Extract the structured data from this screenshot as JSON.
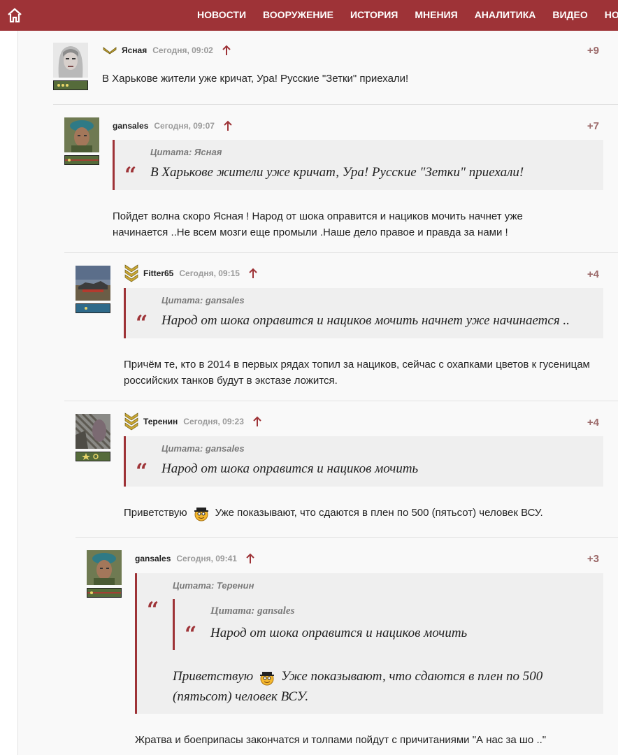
{
  "nav": {
    "home_icon": "home-icon",
    "items": [
      "НОВОСТИ",
      "ВООРУЖЕНИЕ",
      "ИСТОРИЯ",
      "МНЕНИЯ",
      "АНАЛИТИКА",
      "ВИДЕО",
      "НО"
    ]
  },
  "comments": [
    {
      "author": "Ясная",
      "time": "Сегодня, 09:02",
      "score": "+9",
      "text": "В Харькове жители уже кричат, Ура! Русские \"Зетки\" приехали!"
    },
    {
      "author": "gansales",
      "time": "Сегодня, 09:07",
      "score": "+7",
      "quote": {
        "head": "Цитата: Ясная",
        "text": "В Харькове жители уже кричат, Ура! Русские \"Зетки\" приехали!"
      },
      "text": "Пойдет волна скоро Ясная ! Народ от шока оправится и нациков мочить начнет уже начинается ..Не всем мозги еще промыли .Наше дело правое и правда за нами !"
    },
    {
      "author": "Fitter65",
      "time": "Сегодня, 09:15",
      "score": "+4",
      "quote": {
        "head": "Цитата: gansales",
        "text": "Народ от шока оправится и нациков мочить начнет уже начинается .."
      },
      "text": "Причём те, кто в 2014 в первых рядах топил за нациков, сейчас с охапками цветов к гусеницам российских танков будут в экстазе ложится."
    },
    {
      "author": "Теренин",
      "time": "Сегодня, 09:23",
      "score": "+4",
      "quote": {
        "head": "Цитата: gansales",
        "text": "Народ от шока оправится и нациков мочить"
      },
      "text_before": "Приветствую",
      "text_after": "Уже показывают, что сдаются в плен по 500 (пятьсот) человек ВСУ."
    },
    {
      "author": "gansales",
      "time": "Сегодня, 09:41",
      "score": "+3",
      "quote": {
        "head": "Цитата: Теренин",
        "inner_head": "Цитата: gansales",
        "inner_text": "Народ от шока оправится и нациков мочить",
        "text_before": "Приветствую",
        "text_after": "Уже показывают, что сдаются в плен по 500 (пятьсот) человек ВСУ."
      },
      "text": "Жратва и боеприпасы закончатся и толпами пойдут с причитаниями \"А нас за шо ..\""
    }
  ]
}
